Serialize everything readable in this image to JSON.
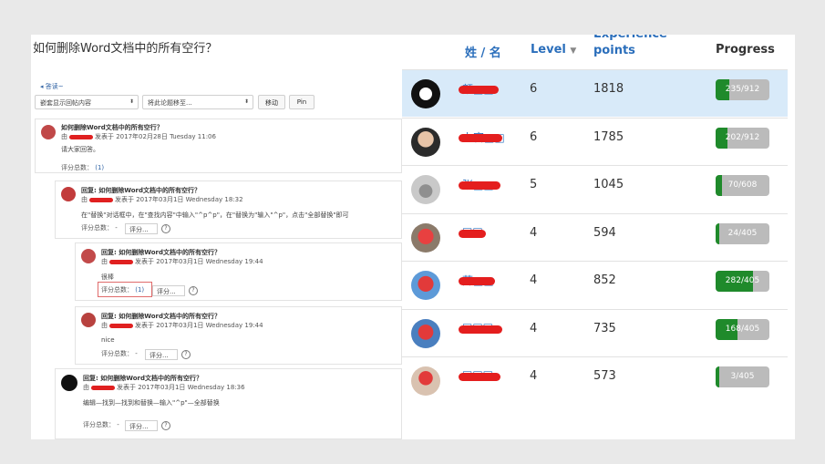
{
  "forum": {
    "title": "如何删除Word文档中的所有空行？",
    "back_link": "◂ 答读~",
    "display_select": "嵌套显示回帖内容",
    "move_select": "将此论题移至...",
    "move_button": "移动",
    "pin_button": "Pin",
    "posts": [
      {
        "subject": "如何删除Word文档中的所有空行？",
        "by_prefix": "由",
        "date": "发表于 2017年02月28日 Tuesday 11:06",
        "message": "请大家回答。",
        "rating_label": "评分总数：",
        "rating_count": "(1)"
      },
      {
        "subject": "回复: 如何删除Word文档中的所有空行？",
        "by_prefix": "由",
        "date": "发表于 2017年03月1日 Wednesday 18:32",
        "message": "在\"替换\"对话框中，在\"查找内容\"中输入\"^p^p\"，在\"替换为\"输入\"^p\"，点击\"全部替换\"即可",
        "rating_label": "评分总数：",
        "rating_count": "-",
        "rate_select": "评分..."
      },
      {
        "subject": "回复: 如何删除Word文档中的所有空行？",
        "by_prefix": "由",
        "date": "发表于 2017年03月1日 Wednesday 19:44",
        "message": "很棒",
        "rating_label": "评分总数：",
        "rating_count": "(1)",
        "rate_select": "评分..."
      },
      {
        "subject": "回复: 如何删除Word文档中的所有空行？",
        "by_prefix": "由",
        "date": "发表于 2017年03月1日 Wednesday 19:44",
        "message": "nice",
        "rating_label": "评分总数：",
        "rating_count": "-",
        "rate_select": "评分..."
      },
      {
        "subject": "回复: 如何删除Word文档中的所有空行？",
        "by_prefix": "由",
        "date": "发表于 2017年03月1日 Wednesday 18:36",
        "message": "编辑—找到—找到和替换—输入\"^p\"—全部替换",
        "rating_label": "评分总数：",
        "rating_count": "-",
        "rate_select": "评分..."
      }
    ]
  },
  "leaderboard": {
    "headers": {
      "name": "姓 / 名",
      "level": "Level",
      "xp_line1": "Experience",
      "xp_line2": "points",
      "progress": "Progress"
    },
    "colors": {
      "accent": "#2a6ebb",
      "bar_fill": "#1f8a2b",
      "bar_track": "#bbbbbb",
      "highlight": "#d8eaf9",
      "scribble": "#e41e1e"
    },
    "rows": [
      {
        "name": "颜□□",
        "level": "6",
        "xp": "1818",
        "progress_text": "235/912",
        "progress_fraction": 0.26
      },
      {
        "name": "上官□□",
        "level": "6",
        "xp": "1785",
        "progress_text": "202/912",
        "progress_fraction": 0.22
      },
      {
        "name": "张□□",
        "level": "5",
        "xp": "1045",
        "progress_text": "70/608",
        "progress_fraction": 0.12
      },
      {
        "name": "□□",
        "level": "4",
        "xp": "594",
        "progress_text": "24/405",
        "progress_fraction": 0.06
      },
      {
        "name": "薛□□",
        "level": "4",
        "xp": "852",
        "progress_text": "282/405",
        "progress_fraction": 0.7
      },
      {
        "name": "□□□",
        "level": "4",
        "xp": "735",
        "progress_text": "168/405",
        "progress_fraction": 0.41
      },
      {
        "name": "□□□",
        "level": "4",
        "xp": "573",
        "progress_text": "3/405",
        "progress_fraction": 0.02
      }
    ]
  }
}
